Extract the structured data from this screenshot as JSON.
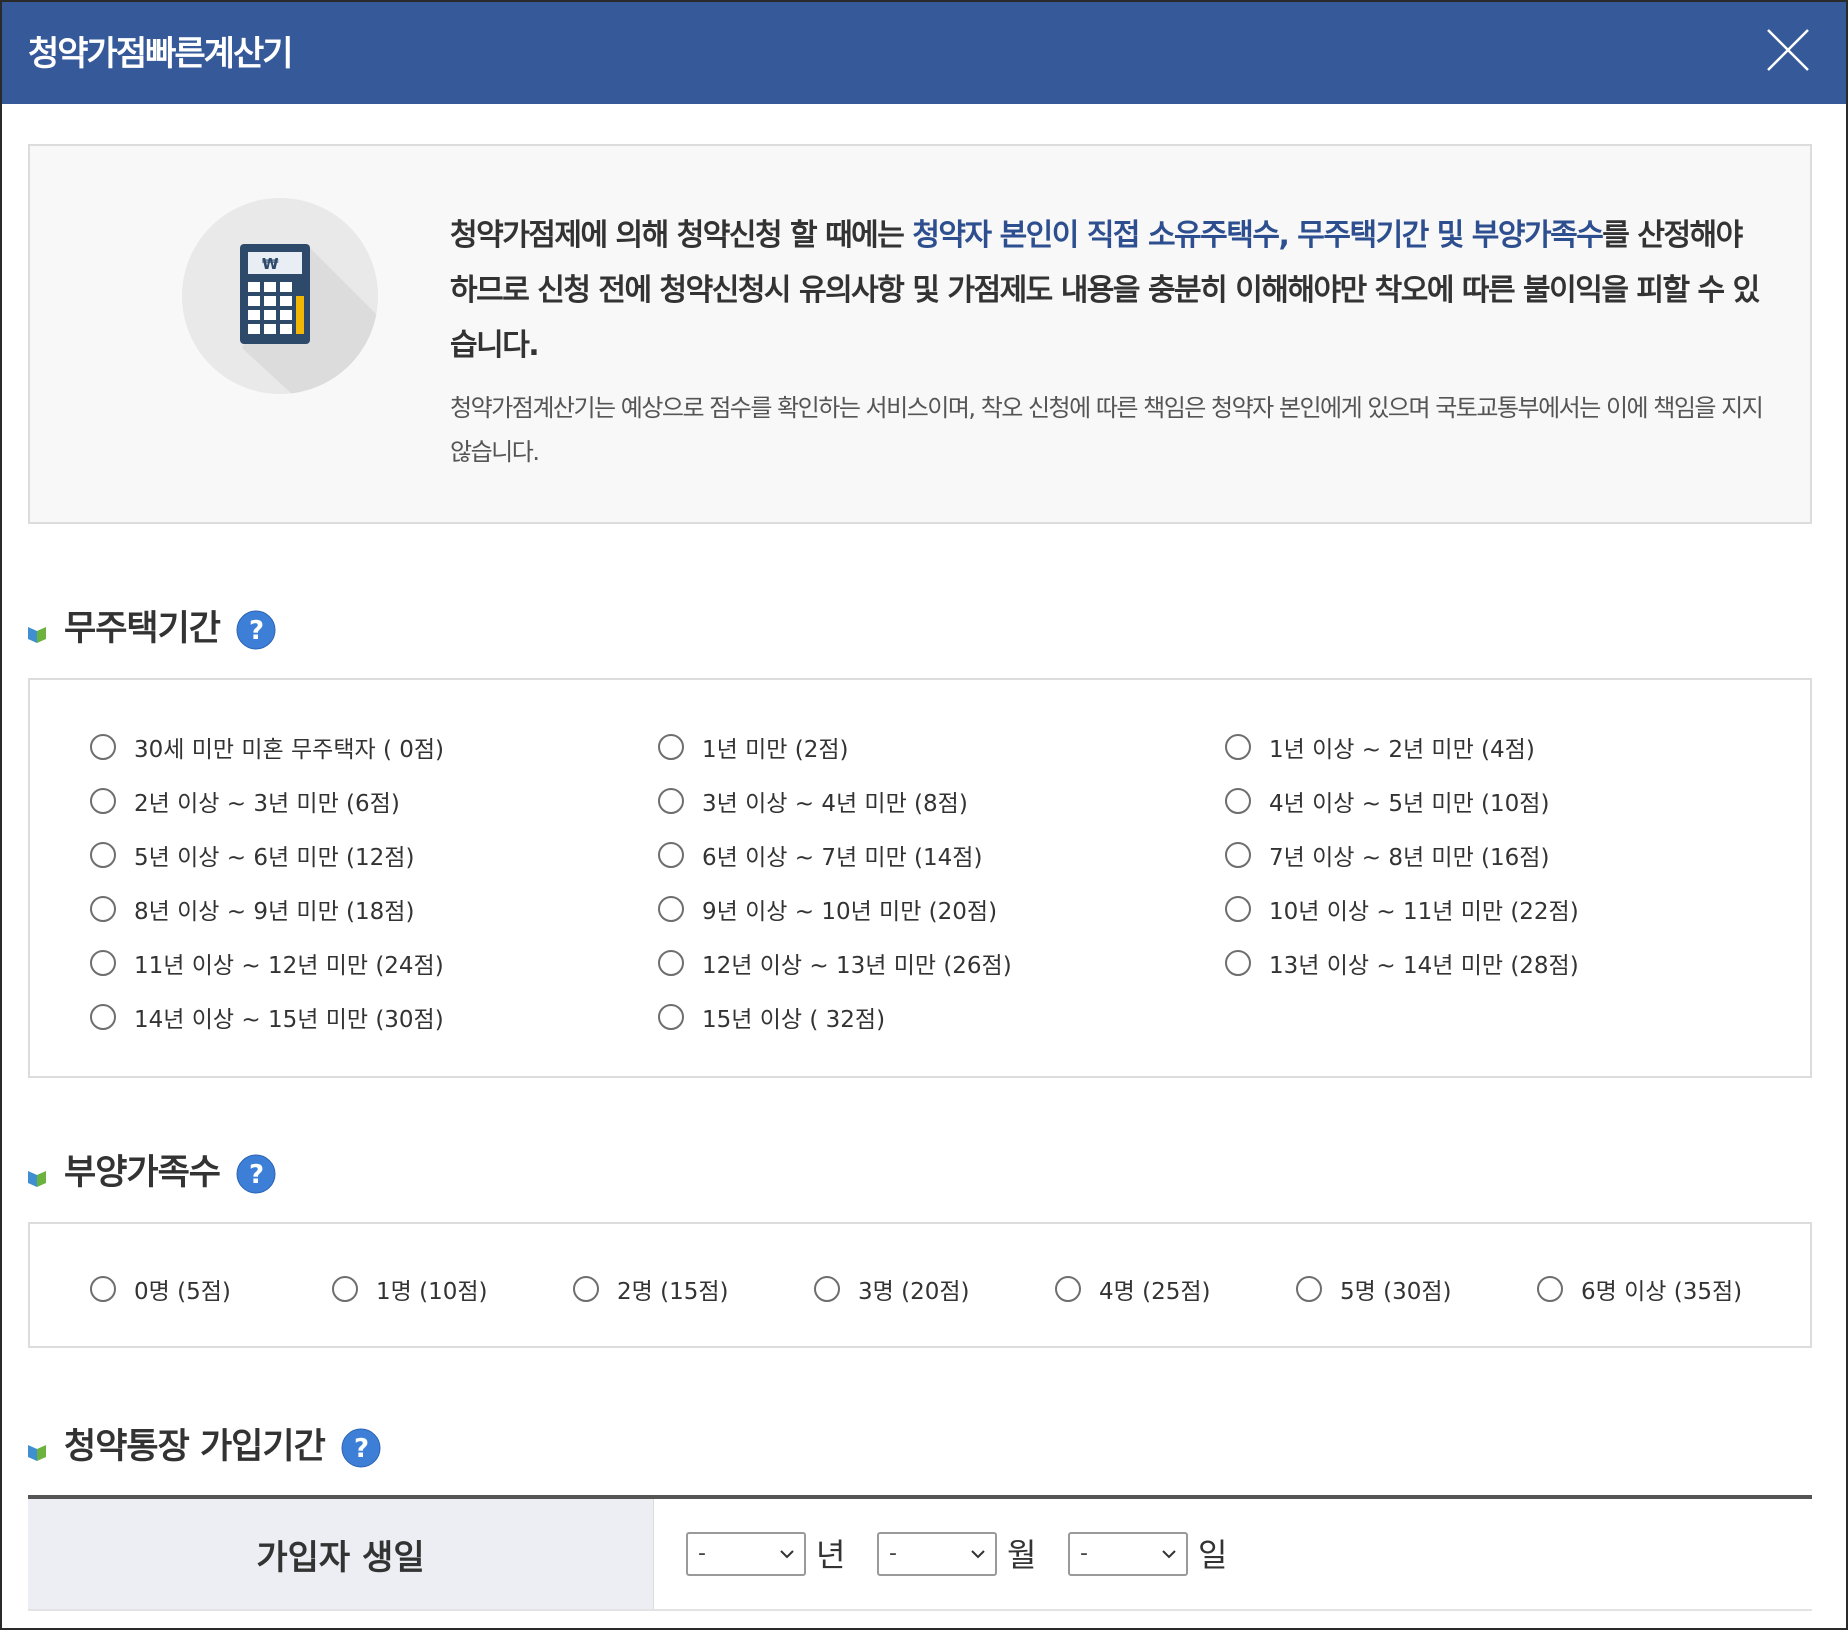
{
  "header": {
    "title": "청약가점빠른계산기"
  },
  "intro": {
    "main_prefix": "청약가점제에 의해 청약신청 할 때에는 ",
    "main_highlight": "청약자 본인이 직접 소유주택수, 무주택기간 및 부양가족수",
    "main_suffix": "를 산정해야 하므로 신청 전에 청약신청시 유의사항 및 가점제도 내용을 충분히 이해해야만 착오에 따른 불이익을 피할 수 있습니다.",
    "sub": "청약가점계산기는 예상으로 점수를 확인하는 서비스이며, 착오 신청에 따른 책임은 청약자 본인에게 있으며 국토교통부에서는 이에 책임을 지지 않습니다."
  },
  "no_house": {
    "title": "무주택기간",
    "options": [
      "30세 미만 미혼 무주택자 ( 0점)",
      "1년 미만 (2점)",
      "1년 이상 ~ 2년 미만 (4점)",
      "2년 이상 ~ 3년 미만 (6점)",
      "3년 이상 ~ 4년 미만 (8점)",
      "4년 이상 ~ 5년 미만 (10점)",
      "5년 이상 ~ 6년 미만 (12점)",
      "6년 이상 ~ 7년 미만 (14점)",
      "7년 이상 ~ 8년 미만 (16점)",
      "8년 이상 ~ 9년 미만 (18점)",
      "9년 이상 ~ 10년 미만 (20점)",
      "10년 이상 ~ 11년 미만 (22점)",
      "11년 이상 ~ 12년 미만 (24점)",
      "12년 이상 ~ 13년 미만 (26점)",
      "13년 이상 ~ 14년 미만 (28점)",
      "14년 이상 ~ 15년 미만 (30점)",
      "15년 이상 ( 32점)"
    ]
  },
  "dependents": {
    "title": "부양가족수",
    "options": [
      "0명 (5점)",
      "1명 (10점)",
      "2명 (15점)",
      "3명 (20점)",
      "4명 (25점)",
      "5명 (30점)",
      "6명 이상 (35점)"
    ]
  },
  "subscription": {
    "title": "청약통장 가입기간",
    "birth_label": "가입자 생일",
    "year_value": "-",
    "year_unit": "년",
    "month_value": "-",
    "month_unit": "월",
    "day_value": "-",
    "day_unit": "일"
  },
  "colors": {
    "header_bg": "#36599a",
    "highlight": "#2e4f8f",
    "help_icon": "#3d7fd6"
  },
  "icons": {
    "close": "close-icon",
    "calculator": "calculator-icon",
    "help": "question-icon",
    "bullet": "book-bullet-icon"
  }
}
